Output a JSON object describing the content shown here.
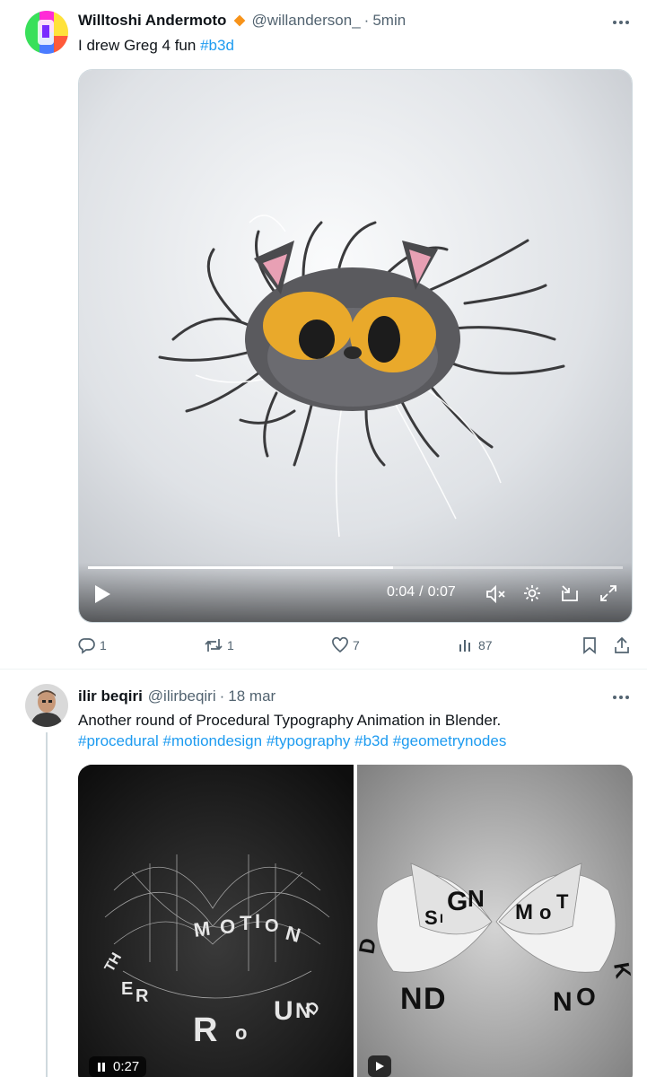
{
  "tweet1": {
    "author_name": "Willtoshi Andermoto",
    "handle": "@willanderson_",
    "separator": "·",
    "time": "5min",
    "text": "I drew Greg 4 fun",
    "hashtag": "#b3d",
    "video": {
      "current_time": "0:04",
      "time_sep": "/",
      "duration": "0:07",
      "progress": 0.57
    },
    "stats": {
      "replies": "1",
      "reposts": "1",
      "likes": "7",
      "views": "87"
    },
    "accent_color": "#f7931a"
  },
  "tweet2": {
    "author_name": "ilir beqiri",
    "handle": "@ilirbeqiri",
    "separator": "·",
    "time": "18 mar",
    "text": "Another round of Procedural Typography Animation in Blender.",
    "hashtags": [
      "#procedural",
      "#motiondesign",
      "#typography",
      "#b3d",
      "#geometrynodes"
    ],
    "left_video_time": "0:27"
  },
  "link_color": "#1d9bf0",
  "muted_color": "#536471",
  "icons": [
    "verified-badge-icon",
    "more-icon",
    "play-icon",
    "pause-icon",
    "mute-icon",
    "settings-icon",
    "pip-icon",
    "fullscreen-icon",
    "reply-icon",
    "repost-icon",
    "like-icon",
    "views-icon",
    "bookmark-icon",
    "share-icon"
  ]
}
